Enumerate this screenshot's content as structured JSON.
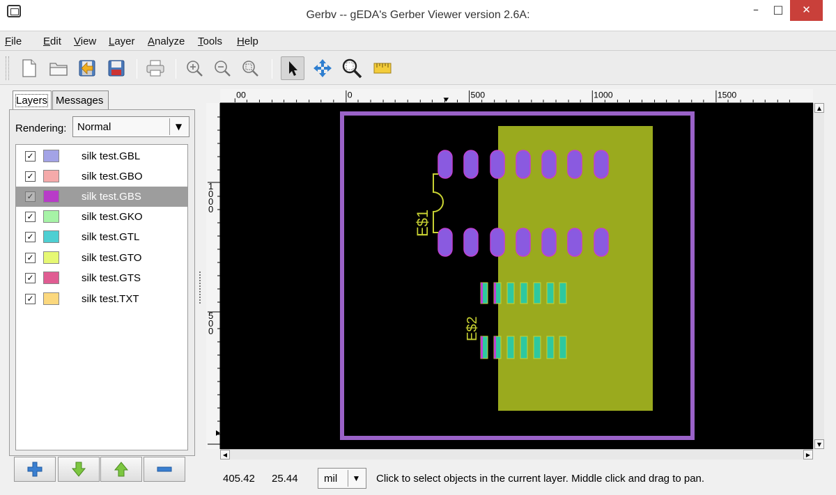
{
  "window": {
    "title": "Gerbv -- gEDA's Gerber Viewer version 2.6A:",
    "minimize_glyph": "–",
    "maximize_glyph": "□",
    "close_glyph": "✕"
  },
  "menu": [
    {
      "mnemonic": "F",
      "rest": "ile"
    },
    {
      "mnemonic": "E",
      "rest": "dit"
    },
    {
      "mnemonic": "V",
      "rest": "iew"
    },
    {
      "mnemonic": "L",
      "rest": "ayer"
    },
    {
      "mnemonic": "A",
      "rest": "nalyze"
    },
    {
      "mnemonic": "T",
      "rest": "ools"
    },
    {
      "mnemonic": "H",
      "rest": "elp"
    }
  ],
  "toolbar": {
    "icons": [
      "new-file-icon",
      "open-folder-icon",
      "revert-icon",
      "save-icon",
      "print-icon",
      "zoom-in-icon",
      "zoom-out-icon",
      "zoom-fit-icon",
      "pointer-tool-icon",
      "pan-tool-icon",
      "zoom-tool-icon",
      "measure-tool-icon"
    ],
    "active_tool": "pointer-tool-icon"
  },
  "sidebar": {
    "tabs": [
      {
        "label": "Layers",
        "active": true
      },
      {
        "label": "Messages",
        "active": false
      }
    ],
    "rendering_label": "Rendering:",
    "rendering_value": "Normal",
    "layers": [
      {
        "name": "silk test.GBL",
        "color": "#a3a3e6",
        "checked": true,
        "selected": false
      },
      {
        "name": "silk test.GBO",
        "color": "#f5aaaa",
        "checked": true,
        "selected": false
      },
      {
        "name": "silk test.GBS",
        "color": "#b83cc8",
        "checked": true,
        "selected": true
      },
      {
        "name": "silk test.GKO",
        "color": "#a6f3a6",
        "checked": true,
        "selected": false
      },
      {
        "name": "silk test.GTL",
        "color": "#4ecfd2",
        "checked": true,
        "selected": false
      },
      {
        "name": "silk test.GTO",
        "color": "#e6f873",
        "checked": true,
        "selected": false
      },
      {
        "name": "silk test.GTS",
        "color": "#e05c92",
        "checked": true,
        "selected": false
      },
      {
        "name": "silk test.TXT",
        "color": "#fbd87e",
        "checked": true,
        "selected": false
      }
    ],
    "layer_buttons": [
      "add-layer-icon",
      "move-down-icon",
      "move-up-icon",
      "remove-layer-icon"
    ]
  },
  "ruler": {
    "h_labels": [
      "00",
      "0",
      "500",
      "1000",
      "1500"
    ],
    "v_labels": [
      "1\n0\n0\n0",
      "5\n0\n0"
    ]
  },
  "board": {
    "designators": [
      "E$1",
      "E$2"
    ],
    "colors": {
      "outline": "#9a62c8",
      "copper_pour": "#9aaa1e",
      "pad": "#8a5ae0",
      "pad_edge": "#c040d0",
      "silk": "#c8d232",
      "smd_pad": "#2ec8a0"
    }
  },
  "status": {
    "x": "405.42",
    "y": "25.44",
    "unit": "mil",
    "message": "Click to select objects in the current layer. Middle click and drag to pan."
  }
}
